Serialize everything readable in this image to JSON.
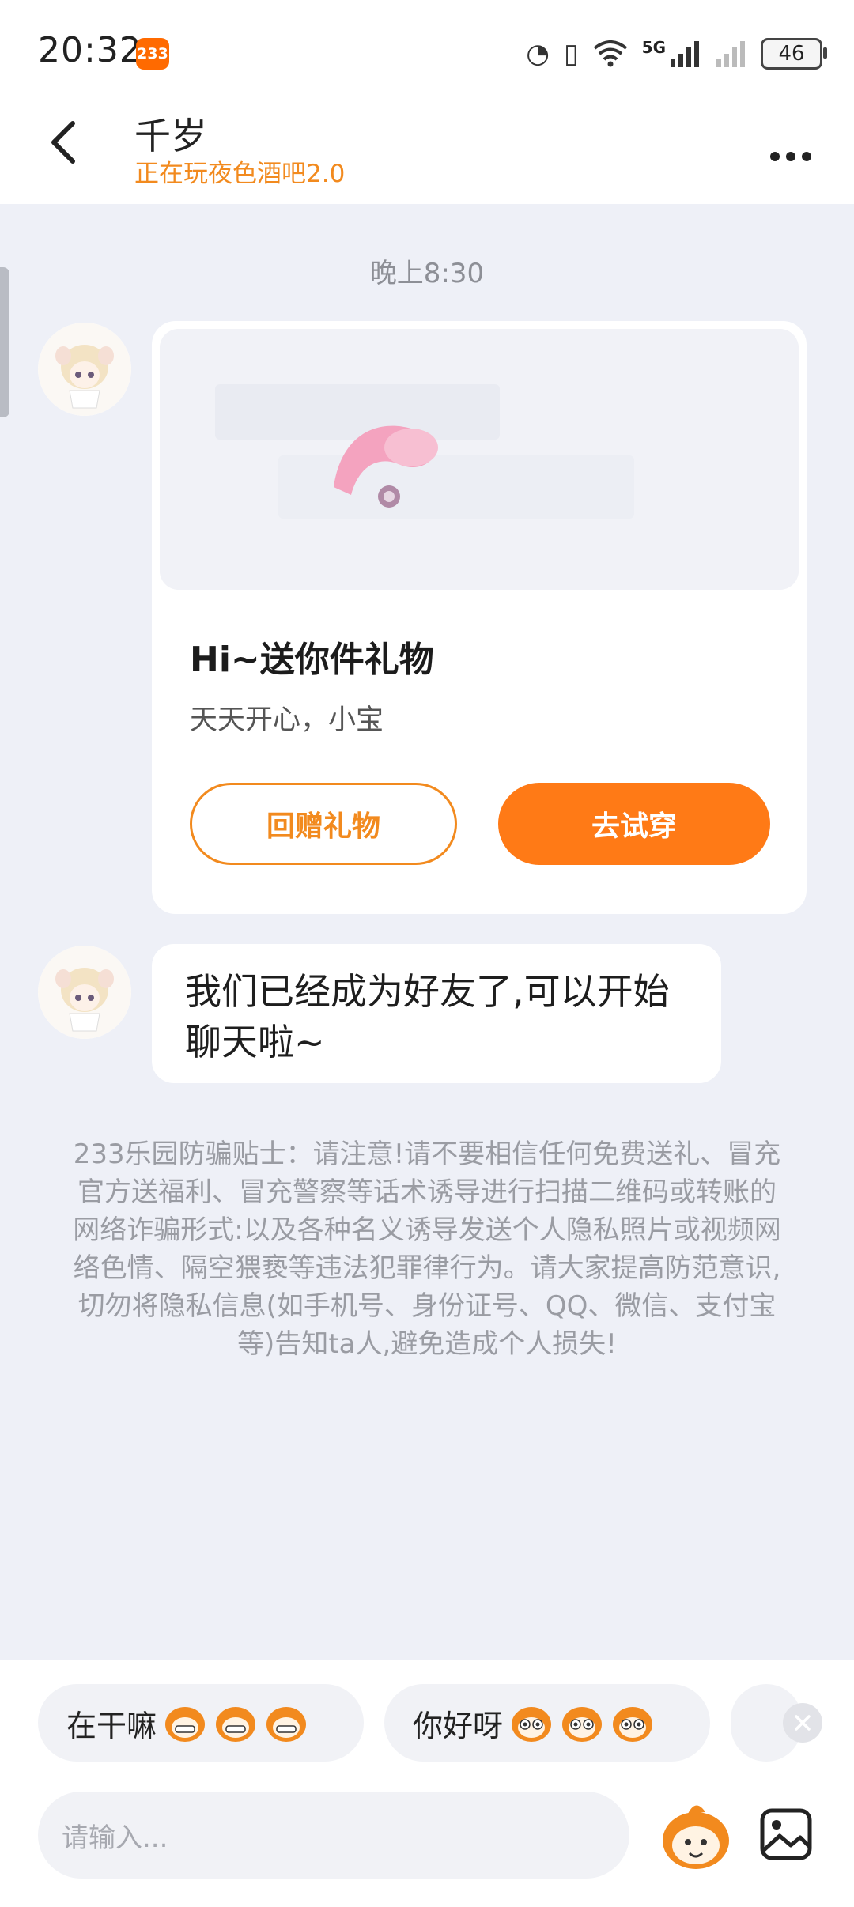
{
  "status_bar": {
    "time": "20:32",
    "app_badge": "233",
    "battery": "46",
    "network": "5G"
  },
  "header": {
    "back_icon": "chevron-left-icon",
    "name": "千岁",
    "status": "正在玩夜色酒吧2.0",
    "more_icon": "more-horizontal-icon"
  },
  "chat": {
    "timestamp": "晚上8:30",
    "gift_card": {
      "title": "Hi~送你件礼物",
      "description": "天天开心，小宝",
      "return_gift_label": "回赠礼物",
      "try_on_label": "去试穿"
    },
    "message": "我们已经成为好友了,可以开始聊天啦~",
    "warning": "233乐园防骗贴士：请注意!请不要相信任何免费送礼、冒充官方送福利、冒充警察等话术诱导进行扫描二维码或转账的网络诈骗形式:以及各种名义诱导发送个人隐私照片或视频网络色情、隔空猥亵等违法犯罪律行为。请大家提高防范意识,切勿将隐私信息(如手机号、身份证号、QQ、微信、支付宝等)告知ta人,避免造成个人损失!"
  },
  "quick_replies": [
    {
      "text": "在干嘛"
    },
    {
      "text": "你好呀"
    }
  ],
  "composer": {
    "placeholder": "请输入..."
  },
  "colors": {
    "accent": "#ff7a16",
    "subtitle": "#f28a1e",
    "background": "#eef0f7"
  }
}
